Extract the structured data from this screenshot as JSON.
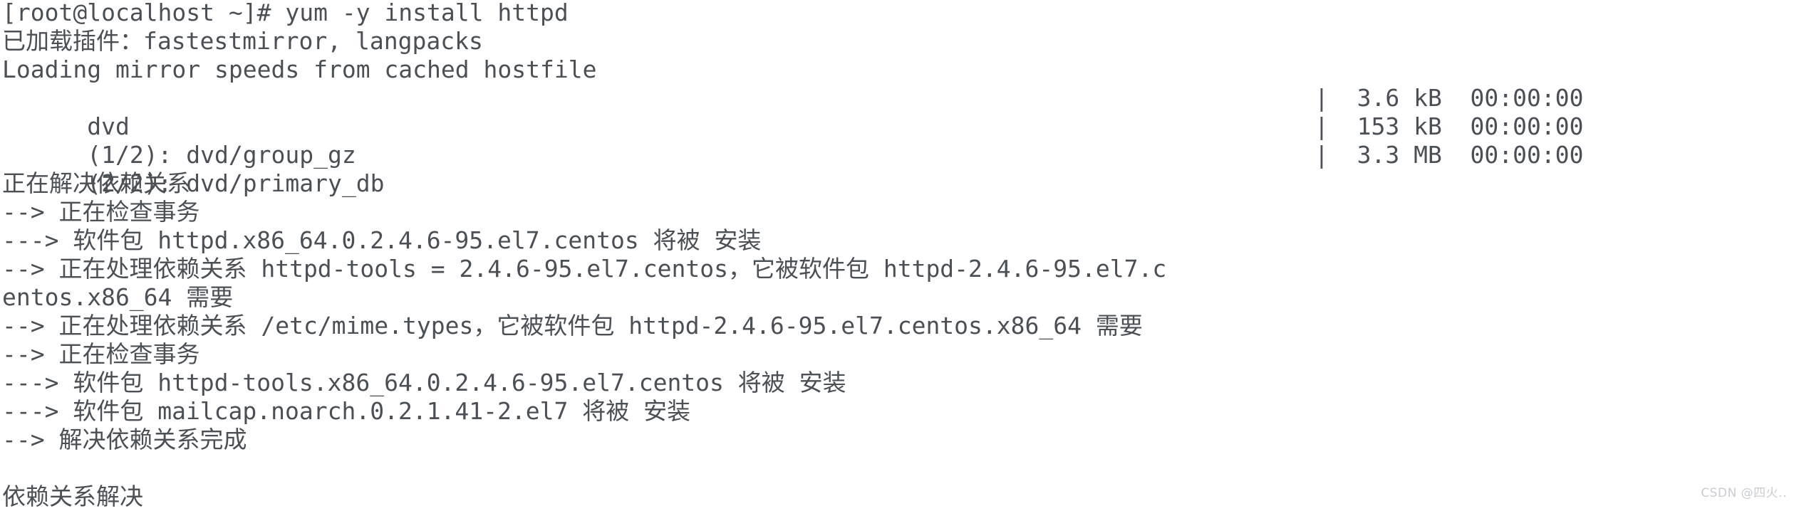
{
  "terminal": {
    "colors": {
      "background": "#ffffff",
      "foreground": "#4a5055",
      "watermark": "#c9cdd1"
    },
    "command": {
      "prompt": "[root@localhost ~]# ",
      "text": "yum -y install httpd",
      "full": "[root@localhost ~]# yum -y install httpd"
    },
    "lines": [
      {
        "id": "prompt-command",
        "text": "[root@localhost ~]# yum -y install httpd"
      },
      {
        "id": "loaded-plugins",
        "text": "已加载插件：fastestmirror, langpacks"
      },
      {
        "id": "loading-mirror-speeds",
        "text": "Loading mirror speeds from cached hostfile"
      },
      {
        "id": "repo-dvd",
        "text": "dvd"
      },
      {
        "id": "download-group-gz",
        "text": "(1/2): dvd/group_gz"
      },
      {
        "id": "download-primary-db",
        "text": "(2/2): dvd/primary_db"
      },
      {
        "id": "resolving-deps",
        "text": "正在解决依赖关系"
      },
      {
        "id": "checking-transaction-1",
        "text": "--> 正在检查事务"
      },
      {
        "id": "package-httpd",
        "text": "---> 软件包 httpd.x86_64.0.2.4.6-95.el7.centos 将被 安装"
      },
      {
        "id": "processing-dep-httpd-tools",
        "text": "--> 正在处理依赖关系 httpd-tools = 2.4.6-95.el7.centos，它被软件包 httpd-2.4.6-95.el7.c"
      },
      {
        "id": "processing-dep-httpd-tools-wrap",
        "text": "entos.x86_64 需要"
      },
      {
        "id": "processing-dep-mime-types",
        "text": "--> 正在处理依赖关系 /etc/mime.types，它被软件包 httpd-2.4.6-95.el7.centos.x86_64 需要"
      },
      {
        "id": "checking-transaction-2",
        "text": "--> 正在检查事务"
      },
      {
        "id": "package-httpd-tools",
        "text": "---> 软件包 httpd-tools.x86_64.0.2.4.6-95.el7.centos 将被 安装"
      },
      {
        "id": "package-mailcap",
        "text": "---> 软件包 mailcap.noarch.0.2.1.41-2.el7 将被 安装"
      },
      {
        "id": "deps-resolved-arrow",
        "text": "--> 解决依赖关系完成"
      },
      {
        "id": "blank-1",
        "text": " "
      },
      {
        "id": "deps-resolved",
        "text": "依赖关系解决"
      }
    ],
    "downloads": [
      {
        "id": "dvd",
        "label": "dvd",
        "separator": "|",
        "size": "3.6 kB",
        "time": "00:00:00"
      },
      {
        "id": "group_gz",
        "label": "(1/2): dvd/group_gz",
        "separator": "|",
        "size": "153 kB",
        "time": "00:00:00"
      },
      {
        "id": "primary_db",
        "label": "(2/2): dvd/primary_db",
        "separator": "|",
        "size": "3.3 MB",
        "time": "00:00:00"
      }
    ],
    "download_right": [
      "|  3.6 kB  00:00:00",
      "|  153 kB  00:00:00",
      "|  3.3 MB  00:00:00"
    ],
    "watermark": "CSDN @四火.."
  }
}
